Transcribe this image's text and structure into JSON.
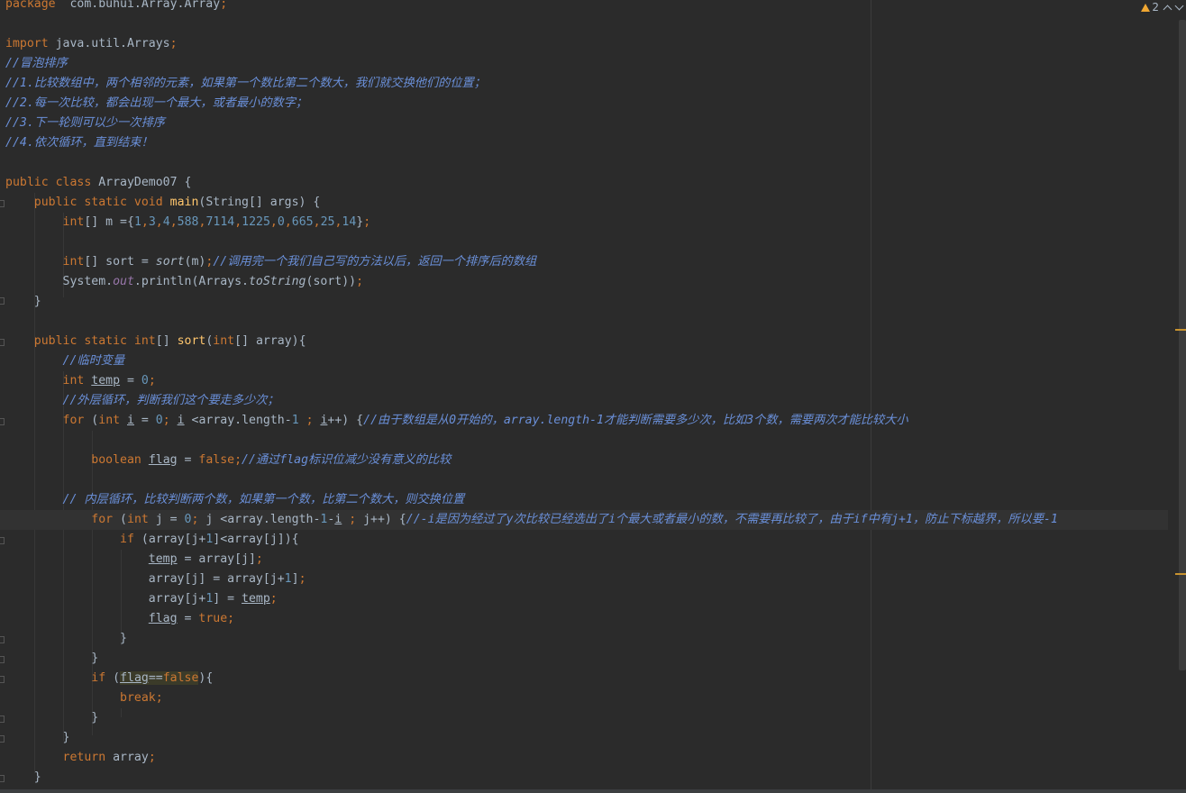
{
  "editor": {
    "warning_count": "2",
    "lines": [
      [
        [
          "kw",
          "package"
        ],
        [
          "",
          "  com.buhui.Array.Array"
        ],
        [
          "kw",
          ";"
        ]
      ],
      [],
      [
        [
          "kw",
          "import"
        ],
        [
          "",
          " java.util.Arrays"
        ],
        [
          "kw",
          ";"
        ]
      ],
      [
        [
          "cmt-doc",
          "//冒泡排序"
        ]
      ],
      [
        [
          "cmt-doc",
          "//1.比较数组中，两个相邻的元素，如果第一个数比第二个数大，我们就交换他们的位置；"
        ]
      ],
      [
        [
          "cmt-doc",
          "//2.每一次比较，都会出现一个最大，或者最小的数字；"
        ]
      ],
      [
        [
          "cmt-doc",
          "//3.下一轮则可以少一次排序"
        ]
      ],
      [
        [
          "cmt-doc",
          "//4.依次循环，直到结束！"
        ]
      ],
      [],
      [
        [
          "kw",
          "public class "
        ],
        [
          "",
          "ArrayDemo07 {"
        ]
      ],
      [
        [
          "",
          "    "
        ],
        [
          "kw",
          "public static void "
        ],
        [
          "fn",
          "main"
        ],
        [
          "",
          "(String[] args) {"
        ]
      ],
      [
        [
          "",
          "        "
        ],
        [
          "kw",
          "int"
        ],
        [
          "",
          "[] m ={"
        ],
        [
          "num",
          "1"
        ],
        [
          "kw",
          ","
        ],
        [
          "num",
          "3"
        ],
        [
          "kw",
          ","
        ],
        [
          "num",
          "4"
        ],
        [
          "kw",
          ","
        ],
        [
          "num",
          "588"
        ],
        [
          "kw",
          ","
        ],
        [
          "num",
          "7114"
        ],
        [
          "kw",
          ","
        ],
        [
          "num",
          "1225"
        ],
        [
          "kw",
          ","
        ],
        [
          "num",
          "0"
        ],
        [
          "kw",
          ","
        ],
        [
          "num",
          "665"
        ],
        [
          "kw",
          ","
        ],
        [
          "num",
          "25"
        ],
        [
          "kw",
          ","
        ],
        [
          "num",
          "14"
        ],
        [
          "",
          "}"
        ],
        [
          "kw",
          ";"
        ]
      ],
      [],
      [
        [
          "",
          "        "
        ],
        [
          "kw",
          "int"
        ],
        [
          "",
          "[] sort = "
        ],
        [
          "static-call",
          "sort"
        ],
        [
          "",
          "(m)"
        ],
        [
          "kw",
          ";"
        ],
        [
          "cmt-doc",
          "//调用完一个我们自己写的方法以后，返回一个排序后的数组"
        ]
      ],
      [
        [
          "",
          "        System."
        ],
        [
          "field",
          "out"
        ],
        [
          "",
          ".println(Arrays."
        ],
        [
          "static-call",
          "toString"
        ],
        [
          "",
          "(sort))"
        ],
        [
          "kw",
          ";"
        ]
      ],
      [
        [
          "",
          "    }"
        ]
      ],
      [],
      [
        [
          "",
          "    "
        ],
        [
          "kw",
          "public static int"
        ],
        [
          "",
          "[] "
        ],
        [
          "fn",
          "sort"
        ],
        [
          "",
          "("
        ],
        [
          "kw",
          "int"
        ],
        [
          "",
          "[] array){"
        ]
      ],
      [
        [
          "",
          "        "
        ],
        [
          "cmt-doc",
          "//临时变量"
        ]
      ],
      [
        [
          "",
          "        "
        ],
        [
          "kw",
          "int "
        ],
        [
          "ul",
          "temp"
        ],
        [
          "",
          " = "
        ],
        [
          "num",
          "0"
        ],
        [
          "kw",
          ";"
        ]
      ],
      [
        [
          "",
          "        "
        ],
        [
          "cmt-doc",
          "//外层循环，判断我们这个要走多少次；"
        ]
      ],
      [
        [
          "",
          "        "
        ],
        [
          "kw",
          "for "
        ],
        [
          "",
          "("
        ],
        [
          "kw",
          "int "
        ],
        [
          "ul",
          "i"
        ],
        [
          "",
          " = "
        ],
        [
          "num",
          "0"
        ],
        [
          "kw",
          "; "
        ],
        [
          "ul",
          "i"
        ],
        [
          "",
          " <array.length-"
        ],
        [
          "num",
          "1"
        ],
        [
          "kw",
          " ; "
        ],
        [
          "ul",
          "i"
        ],
        [
          "",
          "++) {"
        ],
        [
          "cmt-doc",
          "//由于数组是从0开始的，array.length-1才能判断需要多少次，比如3个数，需要两次才能比较大小"
        ]
      ],
      [],
      [
        [
          "",
          "            "
        ],
        [
          "kw",
          "boolean "
        ],
        [
          "ul",
          "flag"
        ],
        [
          "",
          " = "
        ],
        [
          "kw",
          "false;"
        ],
        [
          "cmt-doc",
          "//通过flag标识位减少没有意义的比较"
        ]
      ],
      [],
      [
        [
          "",
          "        "
        ],
        [
          "cmt-doc",
          "// 内层循环，比较判断两个数，如果第一个数，比第二个数大，则交换位置"
        ]
      ],
      [
        [
          "",
          "            "
        ],
        [
          "kw",
          "for "
        ],
        [
          "",
          "("
        ],
        [
          "kw",
          "int "
        ],
        [
          "",
          "j = "
        ],
        [
          "num",
          "0"
        ],
        [
          "kw",
          "; "
        ],
        [
          "",
          "j <array.length-"
        ],
        [
          "num",
          "1"
        ],
        [
          "",
          "-"
        ],
        [
          "ul",
          "i"
        ],
        [
          "kw",
          " ; "
        ],
        [
          "",
          "j++) {"
        ],
        [
          "cmt-doc",
          "//-i是因为经过了y次比较已经选出了i个最大或者最小的数，不需要再比较了，由于if中有j+1，防止下标越界，所以要-1"
        ]
      ],
      [
        [
          "",
          "                "
        ],
        [
          "kw",
          "if "
        ],
        [
          "",
          "(array[j+"
        ],
        [
          "num",
          "1"
        ],
        [
          "",
          "]<array[j]){"
        ]
      ],
      [
        [
          "",
          "                    "
        ],
        [
          "ul",
          "temp"
        ],
        [
          "",
          " = array[j]"
        ],
        [
          "kw",
          ";"
        ]
      ],
      [
        [
          "",
          "                    array[j] = array[j+"
        ],
        [
          "num",
          "1"
        ],
        [
          "",
          "]"
        ],
        [
          "kw",
          ";"
        ]
      ],
      [
        [
          "",
          "                    array[j+"
        ],
        [
          "num",
          "1"
        ],
        [
          "",
          "] = "
        ],
        [
          "ul",
          "temp"
        ],
        [
          "kw",
          ";"
        ]
      ],
      [
        [
          "",
          "                    "
        ],
        [
          "ul",
          "flag"
        ],
        [
          "",
          " = "
        ],
        [
          "kw",
          "true;"
        ]
      ],
      [
        [
          "",
          "                }"
        ]
      ],
      [
        [
          "",
          "            }"
        ]
      ],
      [
        [
          "",
          "            "
        ],
        [
          "kw",
          "if "
        ],
        [
          "",
          "("
        ],
        [
          "hl ul",
          "flag"
        ],
        [
          "hl",
          "=="
        ],
        [
          "hl kw",
          "false"
        ],
        [
          "",
          "){"
        ]
      ],
      [
        [
          "",
          "                "
        ],
        [
          "kw",
          "break;"
        ]
      ],
      [
        [
          "",
          "            }"
        ]
      ],
      [
        [
          "",
          "        }"
        ]
      ],
      [
        [
          "",
          "        "
        ],
        [
          "kw",
          "return "
        ],
        [
          "",
          "array"
        ],
        [
          "kw",
          ";"
        ]
      ],
      [
        [
          "",
          "    }"
        ]
      ]
    ],
    "current_line": 26
  }
}
